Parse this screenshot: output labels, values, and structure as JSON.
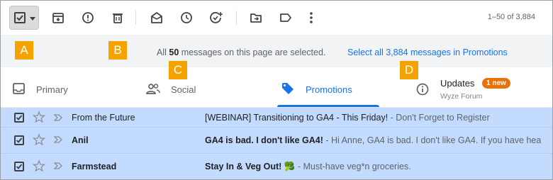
{
  "toolbar": {
    "icons": [
      "select-all-checkbox",
      "archive-icon",
      "report-spam-icon",
      "delete-icon",
      "mark-read-icon",
      "snooze-icon",
      "add-task-icon",
      "move-to-icon",
      "label-icon",
      "more-icon"
    ],
    "pager": "1–50 of 3,884"
  },
  "labels": {
    "a": "A",
    "b": "B",
    "c": "C",
    "d": "D"
  },
  "banner": {
    "prefix": "All",
    "count": "50",
    "suffix": "messages on this page are selected.",
    "link": "Select all 3,884 messages in Promotions"
  },
  "tabs": [
    {
      "label": "Primary",
      "icon": "inbox-icon"
    },
    {
      "label": "Social",
      "icon": "people-icon"
    },
    {
      "label": "Promotions",
      "icon": "tag-icon",
      "active": true
    },
    {
      "label": "Updates",
      "icon": "info-icon",
      "badge": "1 new",
      "subtext": "Wyze Forum"
    }
  ],
  "rows": [
    {
      "sender": "From the Future",
      "subject": "[WEBINAR] Transitioning to GA4 - This Friday!",
      "snippet": " - Don't Forget to Register",
      "unread": false
    },
    {
      "sender": "Anil",
      "subject": "GA4 is bad. I don't like GA4!",
      "snippet": " - Hi Anne, GA4 is bad. I don't like GA4. If you have hea",
      "unread": true
    },
    {
      "sender": "Farmstead",
      "subject": "Stay In & Veg Out! 🥦",
      "snippet": " - Must-have veg*n groceries.",
      "unread": true
    }
  ],
  "colors": {
    "accent": "#1a73e8",
    "label_orange": "#f4a300",
    "badge_orange": "#e8710a",
    "selected_row": "#c2dbff"
  }
}
